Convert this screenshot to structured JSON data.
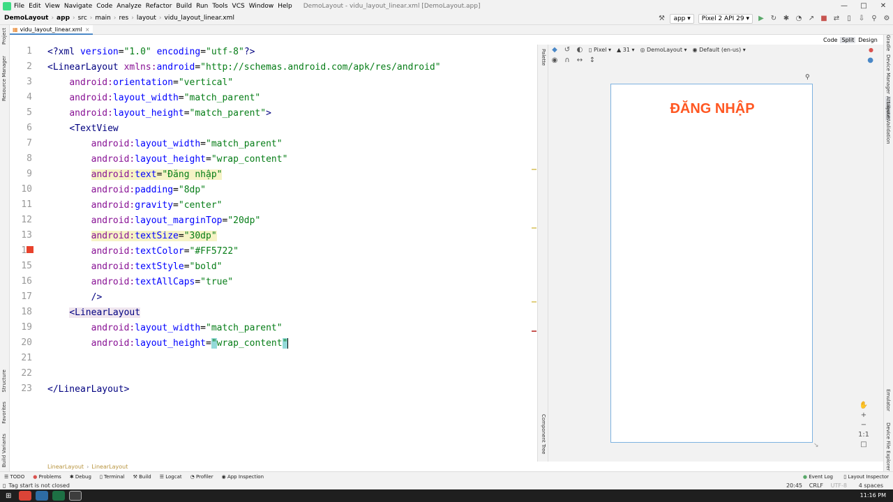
{
  "menubar": {
    "items": [
      "File",
      "Edit",
      "View",
      "Navigate",
      "Code",
      "Analyze",
      "Refactor",
      "Build",
      "Run",
      "Tools",
      "VCS",
      "Window",
      "Help"
    ],
    "title": "DemoLayout - vidu_layout_linear.xml [DemoLayout.app]"
  },
  "navbar": {
    "crumbs": [
      "DemoLayout",
      "app",
      "src",
      "main",
      "res",
      "layout",
      "vidu_layout_linear.xml"
    ],
    "run_config": "app",
    "device": "Pixel 2 API 29"
  },
  "tabs": {
    "active_file": "vidu_layout_linear.xml"
  },
  "left_strip": {
    "project": "Project",
    "resource_manager": "Resource Manager",
    "structure": "Structure",
    "favorites": "Favorites",
    "build_variants": "Build Variants"
  },
  "right_strip": {
    "gradle": "Gradle",
    "device_manager": "Device Manager",
    "attributes": "Attributes",
    "layout_validation": "Layout Validation",
    "emulator": "Emulator",
    "device_file_explorer": "Device File Explorer"
  },
  "editor": {
    "warnings": {
      "errors": "1",
      "warnings": "2",
      "weak": "2"
    },
    "line_numbers": [
      "1",
      "2",
      "3",
      "4",
      "5",
      "6",
      "7",
      "8",
      "9",
      "10",
      "11",
      "12",
      "13",
      "14",
      "15",
      "16",
      "17",
      "18",
      "19",
      "20",
      "21",
      "22",
      "23"
    ]
  },
  "design": {
    "device": "Pixel",
    "api": "31",
    "theme": "DemoLayout",
    "locale": "Default (en-us)",
    "preview_text": "ĐĂNG NHẬP",
    "view_modes": [
      "Code",
      "Split",
      "Design"
    ],
    "palette_label": "Palette",
    "component_tree_label": "Component Tree"
  },
  "breadcrumb": {
    "items": [
      "LinearLayout",
      "LinearLayout"
    ]
  },
  "toolwindows": [
    "TODO",
    "Problems",
    "Debug",
    "Terminal",
    "Build",
    "Logcat",
    "Profiler",
    "App Inspection"
  ],
  "toolwindows_right": [
    "Event Log",
    "Layout Inspector"
  ],
  "status": {
    "message": "Tag start is not closed",
    "position": "20:45",
    "line_sep": "CRLF",
    "encoding": "UTF-8",
    "indent": "4 spaces"
  },
  "taskbar": {
    "clock": "11:16 PM"
  },
  "colors": {
    "accent": "#4a88c7",
    "preview_text": "#ff5722"
  }
}
